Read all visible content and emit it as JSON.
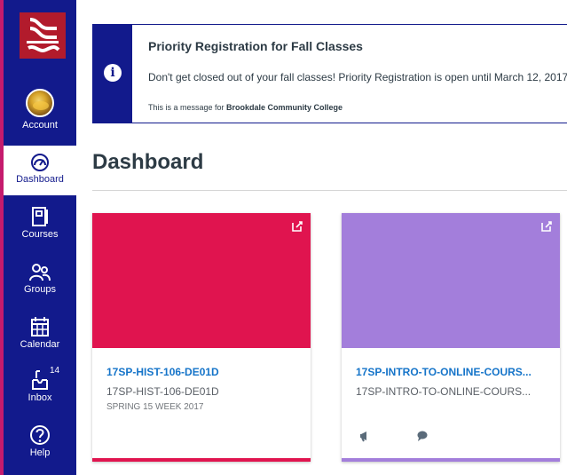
{
  "nav": {
    "items": [
      {
        "label": "Account",
        "icon": "account-avatar"
      },
      {
        "label": "Dashboard",
        "icon": "dashboard-icon",
        "active": true
      },
      {
        "label": "Courses",
        "icon": "courses-icon"
      },
      {
        "label": "Groups",
        "icon": "groups-icon"
      },
      {
        "label": "Calendar",
        "icon": "calendar-icon"
      },
      {
        "label": "Inbox",
        "icon": "inbox-icon",
        "badge": "14"
      },
      {
        "label": "Help",
        "icon": "help-icon"
      }
    ],
    "colors": {
      "background": "#121a8c",
      "accent": "#c51b6d"
    }
  },
  "announcement": {
    "title": "Priority Registration for Fall Classes",
    "body": "Don't get closed out of your fall classes! Priority Registration is open until March 12, 2017",
    "footer_prefix": "This is a message for ",
    "footer_org": "Brookdale Community College",
    "icon": "info-icon"
  },
  "page": {
    "title": "Dashboard"
  },
  "cards": [
    {
      "title": "17SP-HIST-106-DE01D",
      "subtitle": "17SP-HIST-106-DE01D",
      "term": "SPRING 15 WEEK 2017",
      "color": "#e0144f",
      "title_color": "#1574c9"
    },
    {
      "title": "17SP-INTRO-TO-ONLINE-COURS...",
      "subtitle": "17SP-INTRO-TO-ONLINE-COURS...",
      "term": "",
      "color": "#a37edb",
      "title_color": "#1574c9",
      "actions": [
        "announcements-icon",
        "discussions-icon"
      ]
    }
  ]
}
